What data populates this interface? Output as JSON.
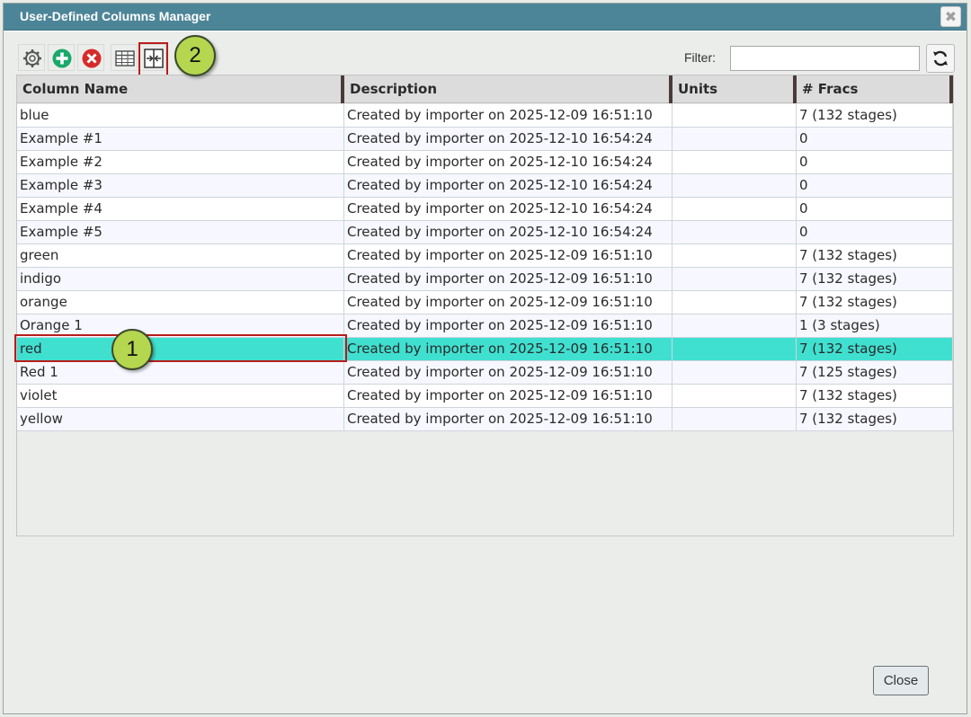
{
  "window": {
    "title": "User-Defined Columns Manager",
    "close_glyph": "✖"
  },
  "toolbar": {
    "buttons": [
      {
        "name": "settings-icon"
      },
      {
        "name": "add-icon"
      },
      {
        "name": "delete-icon"
      },
      {
        "name": "table-icon"
      },
      {
        "name": "merge-columns-icon"
      }
    ],
    "filter_label": "Filter:",
    "filter_value": "",
    "refresh_icon": "refresh-icon"
  },
  "grid": {
    "columns": [
      "Column Name",
      "Description",
      "Units",
      "# Fracs"
    ],
    "rows": [
      {
        "name": "blue",
        "description": "Created by importer on 2025-12-09 16:51:10",
        "units": "",
        "fracs": "7 (132 stages)"
      },
      {
        "name": "Example #1",
        "description": "Created by importer on 2025-12-10 16:54:24",
        "units": "",
        "fracs": "0"
      },
      {
        "name": "Example #2",
        "description": "Created by importer on 2025-12-10 16:54:24",
        "units": "",
        "fracs": "0"
      },
      {
        "name": "Example #3",
        "description": "Created by importer on 2025-12-10 16:54:24",
        "units": "",
        "fracs": "0"
      },
      {
        "name": "Example #4",
        "description": "Created by importer on 2025-12-10 16:54:24",
        "units": "",
        "fracs": "0"
      },
      {
        "name": "Example #5",
        "description": "Created by importer on 2025-12-10 16:54:24",
        "units": "",
        "fracs": "0"
      },
      {
        "name": "green",
        "description": "Created by importer on 2025-12-09 16:51:10",
        "units": "",
        "fracs": "7 (132 stages)"
      },
      {
        "name": "indigo",
        "description": "Created by importer on 2025-12-09 16:51:10",
        "units": "",
        "fracs": "7 (132 stages)"
      },
      {
        "name": "orange",
        "description": "Created by importer on 2025-12-09 16:51:10",
        "units": "",
        "fracs": "7 (132 stages)"
      },
      {
        "name": "Orange 1",
        "description": "Created by importer on 2025-12-09 16:51:10",
        "units": "",
        "fracs": "1 (3 stages)"
      },
      {
        "name": "red",
        "description": "Created by importer on 2025-12-09 16:51:10",
        "units": "",
        "fracs": "7 (132 stages)",
        "selected": true
      },
      {
        "name": "Red 1",
        "description": "Created by importer on 2025-12-09 16:51:10",
        "units": "",
        "fracs": "7 (125 stages)"
      },
      {
        "name": "violet",
        "description": "Created by importer on 2025-12-09 16:51:10",
        "units": "",
        "fracs": "7 (132 stages)"
      },
      {
        "name": "yellow",
        "description": "Created by importer on 2025-12-09 16:51:10",
        "units": "",
        "fracs": "7 (132 stages)"
      }
    ]
  },
  "callouts": {
    "one": "1",
    "two": "2"
  },
  "footer": {
    "close_label": "Close"
  },
  "colors": {
    "titlebar": "#4d8598",
    "selected_row": "#40e0d0",
    "callout": "#b5d64f",
    "highlight": "#b81c1c"
  }
}
